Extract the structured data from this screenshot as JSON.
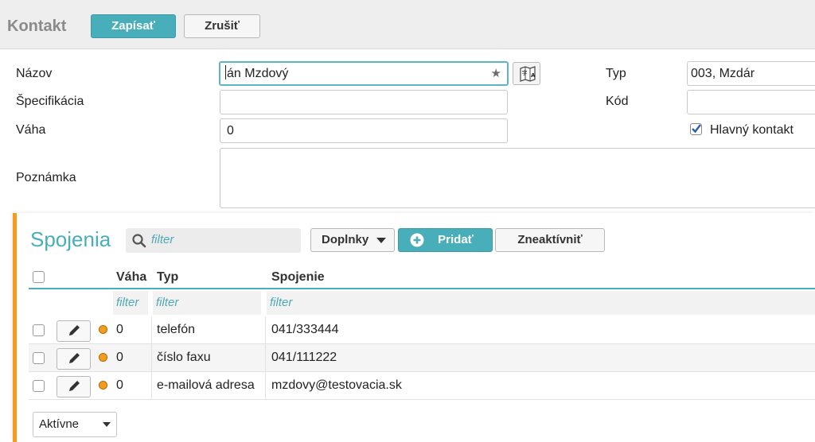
{
  "header": {
    "title": "Kontakt",
    "save_label": "Zapísať",
    "cancel_label": "Zrušiť"
  },
  "form": {
    "name_label": "Názov",
    "name_value": "Ján Mzdový",
    "name_value_visible": "án Mzdový",
    "spec_label": "Špecifikácia",
    "spec_value": "",
    "weight_label": "Váha",
    "weight_value": "0",
    "note_label": "Poznámka",
    "note_value": "",
    "type_label": "Typ",
    "type_value": "003, Mzdár",
    "code_label": "Kód",
    "code_value": "",
    "main_contact_label": "Hlavný kontakt",
    "main_contact_checked": true
  },
  "connections": {
    "title": "Spojenia",
    "search_placeholder": "filter",
    "addons_label": "Doplnky",
    "add_label": "Pridať",
    "deactivate_label": "Zneaktívniť",
    "columns": [
      "Váha",
      "Typ",
      "Spojenie"
    ],
    "filter_placeholder": "filter",
    "rows": [
      {
        "weight": "0",
        "type": "telefón",
        "value": "041/333444"
      },
      {
        "weight": "0",
        "type": "číslo faxu",
        "value": "041/111222"
      },
      {
        "weight": "0",
        "type": "e-mailová adresa",
        "value": "mzdovy@testovacia.sk"
      }
    ],
    "status_filter": "Aktívne",
    "status_color": "#f39c1e"
  },
  "colors": {
    "accent": "#48aeba",
    "panel_border": "#f39c1e"
  }
}
